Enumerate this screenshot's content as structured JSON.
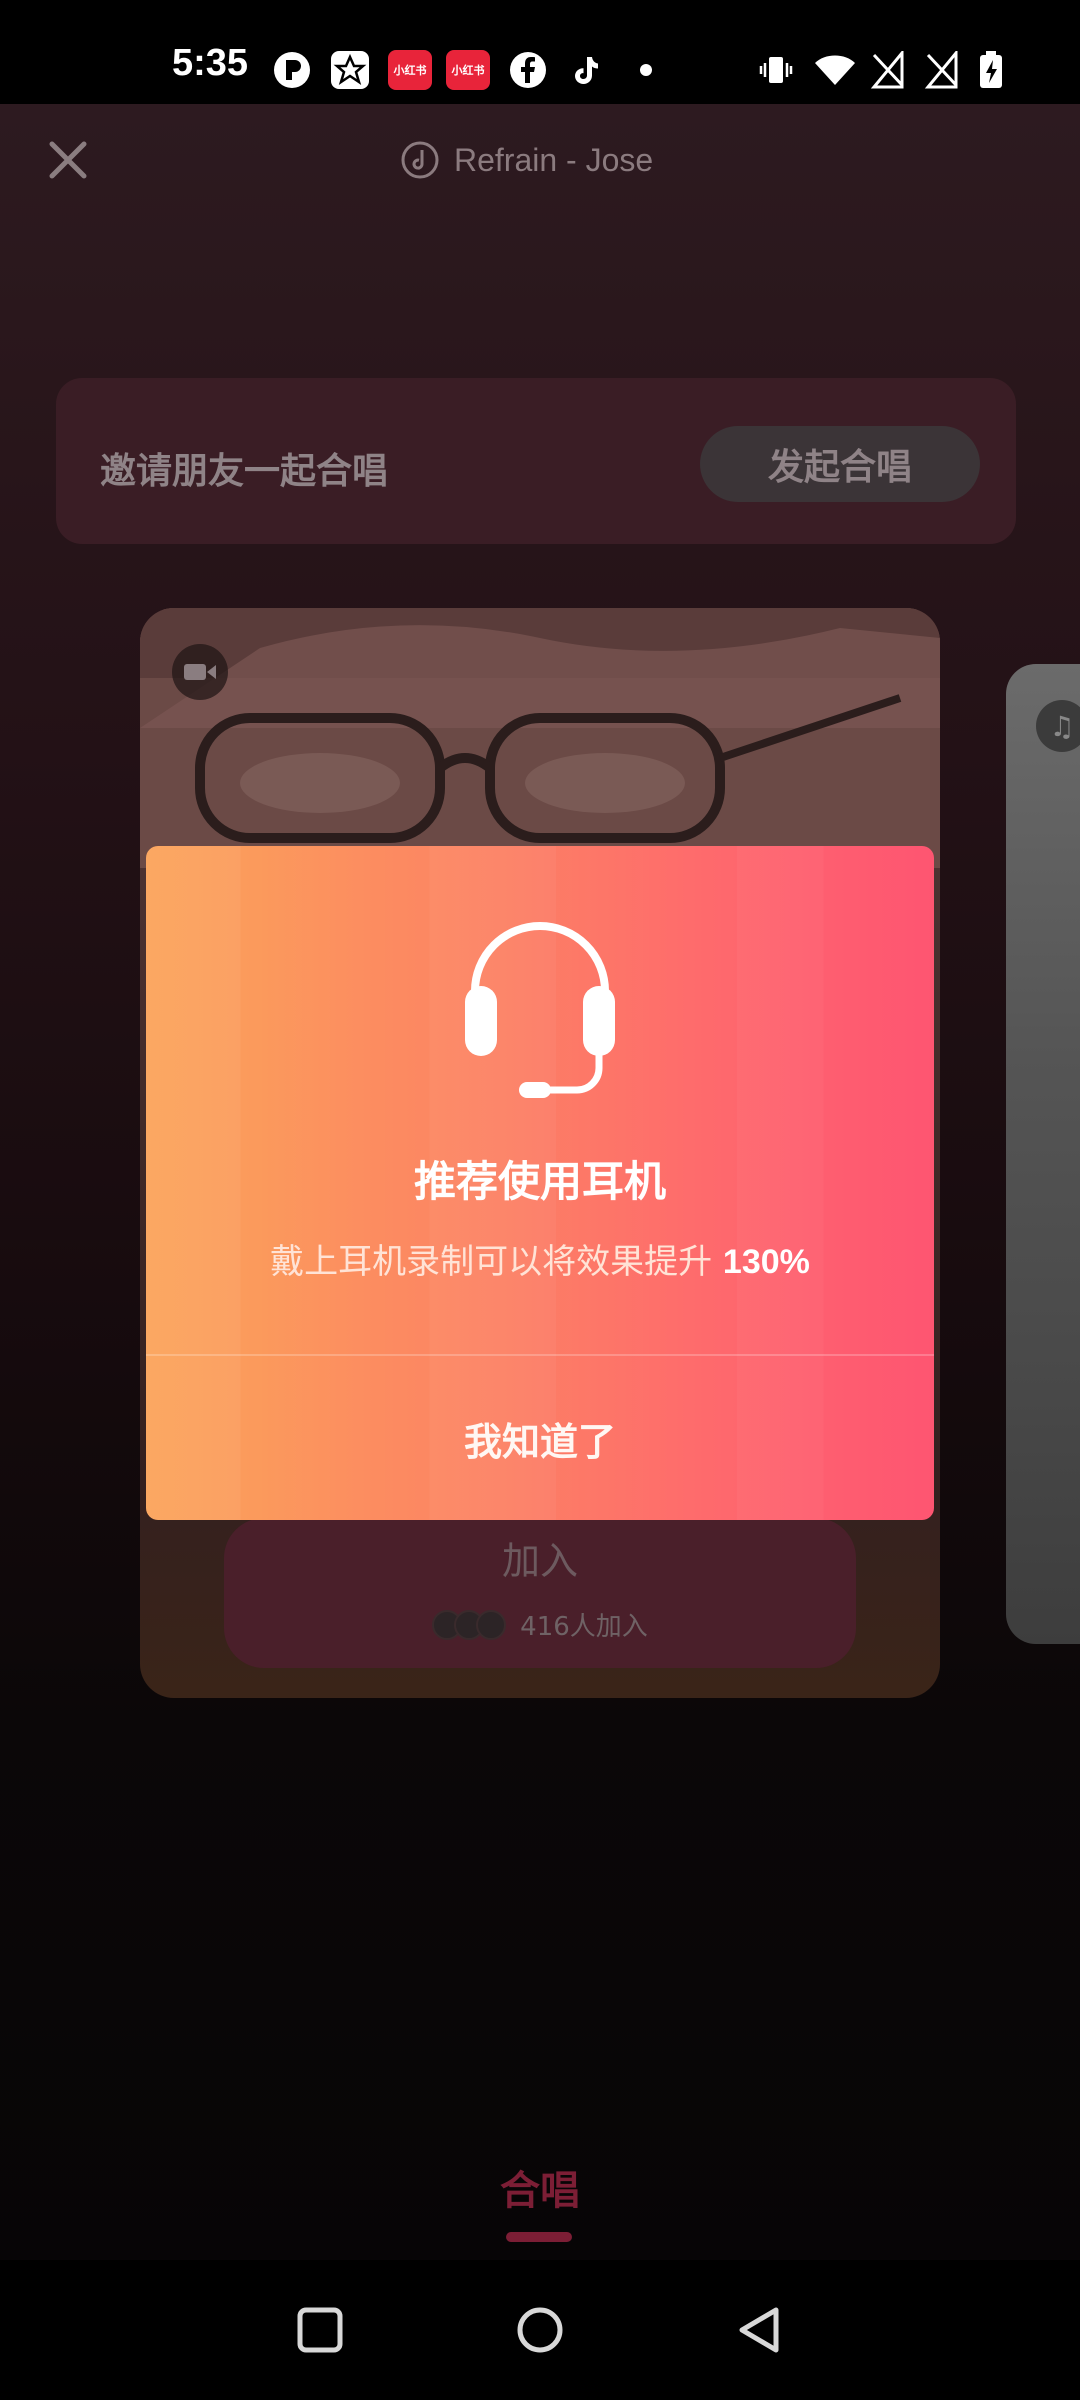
{
  "status_bar": {
    "time": "5:35",
    "app_icons": [
      {
        "name": "p-app-icon",
        "label": "",
        "color": "#ffffff"
      },
      {
        "name": "star-app-icon",
        "label": "",
        "color": "#ffffff"
      },
      {
        "name": "xiaohongshu-icon",
        "label": "小红书",
        "color": "#e8243a"
      },
      {
        "name": "xiaohongshu-icon-2",
        "label": "小红书",
        "color": "#e8243a"
      },
      {
        "name": "facebook-icon",
        "label": "",
        "color": "#ffffff"
      },
      {
        "name": "tiktok-icon",
        "label": "",
        "color": "#ffffff"
      }
    ],
    "system_icons": [
      "vibrate-icon",
      "wifi-icon",
      "no-sim-icon",
      "no-sim-icon",
      "battery-charging-icon"
    ]
  },
  "topbar": {
    "close_icon": "close-icon",
    "song_title": "Refrain - Jose"
  },
  "invite": {
    "text": "邀请朋友一起合唱",
    "button_label": "发起合唱"
  },
  "card": {
    "video_icon": "video-camera-icon",
    "join_label": "加入",
    "join_count": "416人加入"
  },
  "modal": {
    "icon": "headphones-icon",
    "title": "推荐使用耳机",
    "subtitle": "戴上耳机录制可以将效果提升",
    "highlight": "130%",
    "confirm_label": "我知道了",
    "gradient_colors": [
      "#fba35a",
      "#fe5571"
    ]
  },
  "bottom_nav": {
    "tab_label": "合唱",
    "accent": "#7c1e35"
  },
  "system_nav": [
    "recents-icon",
    "home-icon",
    "back-icon"
  ]
}
